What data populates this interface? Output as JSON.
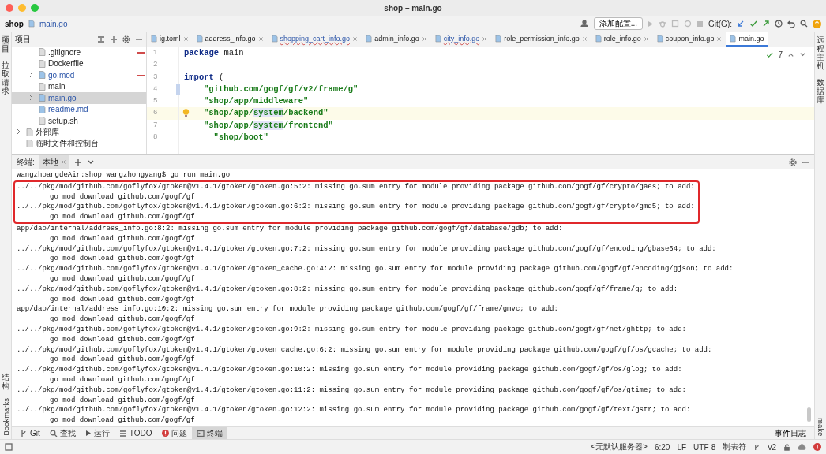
{
  "window": {
    "title": "shop – main.go"
  },
  "toolbar": {
    "breadcrumb": [
      "shop",
      "main.go"
    ],
    "run_config": "添加配置...",
    "git_label": "Git(G):"
  },
  "left_strip": {
    "top": [
      {
        "label": "项目",
        "selected": true
      },
      {
        "label": "拉取请求",
        "selected": false
      }
    ],
    "bottom": [
      {
        "label": "结构",
        "selected": false
      },
      {
        "label": "Bookmarks",
        "selected": false
      }
    ]
  },
  "right_strip": {
    "top": [
      {
        "label": "远程主机"
      },
      {
        "label": "数据库"
      }
    ],
    "bottom": [
      {
        "label": "make"
      }
    ]
  },
  "project_panel": {
    "title": "项目",
    "shop_children": [
      {
        "name": ".gitignore",
        "expandable": false,
        "modified": false,
        "marked": true,
        "selected": false
      },
      {
        "name": "Dockerfile",
        "expandable": false,
        "modified": false,
        "marked": false,
        "selected": false
      },
      {
        "name": "go.mod",
        "expandable": true,
        "modified": true,
        "marked": true,
        "selected": false
      },
      {
        "name": "main",
        "expandable": false,
        "modified": false,
        "marked": false,
        "selected": false
      },
      {
        "name": "main.go",
        "expandable": true,
        "modified": true,
        "marked": false,
        "selected": true
      },
      {
        "name": "readme.md",
        "expandable": false,
        "modified": true,
        "marked": false,
        "selected": false
      },
      {
        "name": "setup.sh",
        "expandable": false,
        "modified": false,
        "marked": false,
        "selected": false
      }
    ],
    "top_level": [
      {
        "name": "外部库",
        "expandable": true,
        "modified": false,
        "marked": false,
        "selected": false
      },
      {
        "name": "临时文件和控制台",
        "expandable": false,
        "modified": false,
        "marked": false,
        "selected": false
      }
    ]
  },
  "editor_tabs": [
    {
      "label": "ig.toml",
      "selected": false,
      "error": false
    },
    {
      "label": "address_info.go",
      "selected": false,
      "error": false
    },
    {
      "label": "shopping_cart_info.go",
      "selected": false,
      "error": true
    },
    {
      "label": "admin_info.go",
      "selected": false,
      "error": false
    },
    {
      "label": "city_info.go",
      "selected": false,
      "error": true
    },
    {
      "label": "role_permission_info.go",
      "selected": false,
      "error": false
    },
    {
      "label": "role_info.go",
      "selected": false,
      "error": false
    },
    {
      "label": "coupon_info.go",
      "selected": false,
      "error": false
    },
    {
      "label": "main.go",
      "selected": true,
      "error": false
    }
  ],
  "editor": {
    "inspection_count": "7",
    "lines": [
      {
        "number": "1",
        "current": false,
        "changed": false,
        "bulb": false,
        "indent": false,
        "tokens": [
          {
            "t": "package",
            "kind": "keyword"
          },
          {
            "t": "main",
            "kind": "plain"
          }
        ]
      },
      {
        "number": "2",
        "current": false,
        "changed": false,
        "bulb": false
      },
      {
        "number": "3",
        "current": false,
        "changed": false,
        "bulb": false,
        "indent": false,
        "tokens": [
          {
            "t": "import",
            "kind": "keyword"
          },
          {
            "t": "(",
            "kind": "plain"
          }
        ]
      },
      {
        "number": "4",
        "current": false,
        "changed": true,
        "bulb": false,
        "indent": true,
        "tokens": [
          {
            "t": "\"github.com/gogf/gf/v2/frame/g\"",
            "kind": "string"
          }
        ]
      },
      {
        "number": "5",
        "current": false,
        "changed": false,
        "bulb": false,
        "indent": true,
        "tokens": [
          {
            "t": "\"shop/app/middleware\"",
            "kind": "string"
          }
        ]
      },
      {
        "number": "6",
        "current": true,
        "changed": false,
        "bulb": true,
        "indent": true,
        "tokens": [
          {
            "t": "\"shop/app/",
            "kind": "string"
          },
          {
            "t": "system",
            "kind": "match"
          },
          {
            "t": "/backend\"",
            "kind": "string"
          }
        ]
      },
      {
        "number": "7",
        "current": false,
        "changed": false,
        "bulb": false,
        "indent": true,
        "tokens": [
          {
            "t": "\"shop/app/",
            "kind": "string"
          },
          {
            "t": "system",
            "kind": "match"
          },
          {
            "t": "/frontend\"",
            "kind": "string"
          }
        ]
      },
      {
        "number": "8",
        "current": false,
        "changed": false,
        "bulb": false,
        "indent": true,
        "tokens": [
          {
            "t": "_",
            "kind": "plain"
          },
          {
            "t": "\"shop/boot\"",
            "kind": "string"
          }
        ]
      }
    ]
  },
  "terminal": {
    "label": "终端:",
    "tabs": [
      {
        "label": "本地",
        "selected": true
      }
    ],
    "lines": [
      {
        "text": "wangzhoangdeAir:shop wangzhongyang$ go run main.go",
        "indent": false,
        "highlighted": false
      },
      {
        "text": "../../pkg/mod/github.com/goflyfox/gtoken@v1.4.1/gtoken/gtoken.go:5:2: missing go.sum entry for module providing package github.com/gogf/gf/crypto/gaes; to add:",
        "indent": false,
        "highlighted": true
      },
      {
        "text": "go mod download github.com/gogf/gf",
        "indent": true,
        "highlighted": true
      },
      {
        "text": "../../pkg/mod/github.com/goflyfox/gtoken@v1.4.1/gtoken/gtoken.go:6:2: missing go.sum entry for module providing package github.com/gogf/gf/crypto/gmd5; to add:",
        "indent": false,
        "highlighted": true
      },
      {
        "text": "go mod download github.com/gogf/gf",
        "indent": true,
        "highlighted": true
      },
      {
        "text": "app/dao/internal/address_info.go:8:2: missing go.sum entry for module providing package github.com/gogf/gf/database/gdb; to add:",
        "indent": false,
        "highlighted": false
      },
      {
        "text": "go mod download github.com/gogf/gf",
        "indent": true,
        "highlighted": false
      },
      {
        "text": "../../pkg/mod/github.com/goflyfox/gtoken@v1.4.1/gtoken/gtoken.go:7:2: missing go.sum entry for module providing package github.com/gogf/gf/encoding/gbase64; to add:",
        "indent": false,
        "highlighted": false
      },
      {
        "text": "go mod download github.com/gogf/gf",
        "indent": true,
        "highlighted": false
      },
      {
        "text": "../../pkg/mod/github.com/goflyfox/gtoken@v1.4.1/gtoken/gtoken_cache.go:4:2: missing go.sum entry for module providing package github.com/gogf/gf/encoding/gjson; to add:",
        "indent": false,
        "highlighted": false
      },
      {
        "text": "go mod download github.com/gogf/gf",
        "indent": true,
        "highlighted": false
      },
      {
        "text": "../../pkg/mod/github.com/goflyfox/gtoken@v1.4.1/gtoken/gtoken.go:8:2: missing go.sum entry for module providing package github.com/gogf/gf/frame/g; to add:",
        "indent": false,
        "highlighted": false
      },
      {
        "text": "go mod download github.com/gogf/gf",
        "indent": true,
        "highlighted": false
      },
      {
        "text": "app/dao/internal/address_info.go:10:2: missing go.sum entry for module providing package github.com/gogf/gf/frame/gmvc; to add:",
        "indent": false,
        "highlighted": false
      },
      {
        "text": "go mod download github.com/gogf/gf",
        "indent": true,
        "highlighted": false
      },
      {
        "text": "../../pkg/mod/github.com/goflyfox/gtoken@v1.4.1/gtoken/gtoken.go:9:2: missing go.sum entry for module providing package github.com/gogf/gf/net/ghttp; to add:",
        "indent": false,
        "highlighted": false
      },
      {
        "text": "go mod download github.com/gogf/gf",
        "indent": true,
        "highlighted": false
      },
      {
        "text": "../../pkg/mod/github.com/goflyfox/gtoken@v1.4.1/gtoken/gtoken_cache.go:6:2: missing go.sum entry for module providing package github.com/gogf/gf/os/gcache; to add:",
        "indent": false,
        "highlighted": false
      },
      {
        "text": "go mod download github.com/gogf/gf",
        "indent": true,
        "highlighted": false
      },
      {
        "text": "../../pkg/mod/github.com/goflyfox/gtoken@v1.4.1/gtoken/gtoken.go:10:2: missing go.sum entry for module providing package github.com/gogf/gf/os/glog; to add:",
        "indent": false,
        "highlighted": false
      },
      {
        "text": "go mod download github.com/gogf/gf",
        "indent": true,
        "highlighted": false
      },
      {
        "text": "../../pkg/mod/github.com/goflyfox/gtoken@v1.4.1/gtoken/gtoken.go:11:2: missing go.sum entry for module providing package github.com/gogf/gf/os/gtime; to add:",
        "indent": false,
        "highlighted": false
      },
      {
        "text": "go mod download github.com/gogf/gf",
        "indent": true,
        "highlighted": false
      },
      {
        "text": "../../pkg/mod/github.com/goflyfox/gtoken@v1.4.1/gtoken/gtoken.go:12:2: missing go.sum entry for module providing package github.com/gogf/gf/text/gstr; to add:",
        "indent": false,
        "highlighted": false
      },
      {
        "text": "go mod download github.com/gogf/gf",
        "indent": true,
        "highlighted": false
      }
    ]
  },
  "tool_windows": [
    {
      "label": "Git",
      "kind": "git",
      "selected": false
    },
    {
      "label": "查找",
      "kind": "find",
      "selected": false
    },
    {
      "label": "运行",
      "kind": "run",
      "selected": false
    },
    {
      "label": "TODO",
      "kind": "todo",
      "selected": false
    },
    {
      "label": "问题",
      "kind": "problems",
      "selected": false
    },
    {
      "label": "终端",
      "kind": "terminal",
      "selected": true
    }
  ],
  "event_log": "事件日志",
  "status_bar": {
    "server": "<无默认服务器>",
    "position": "6:20",
    "line_ending": "LF",
    "encoding": "UTF-8",
    "indent": "制表符",
    "branch": "v2"
  }
}
